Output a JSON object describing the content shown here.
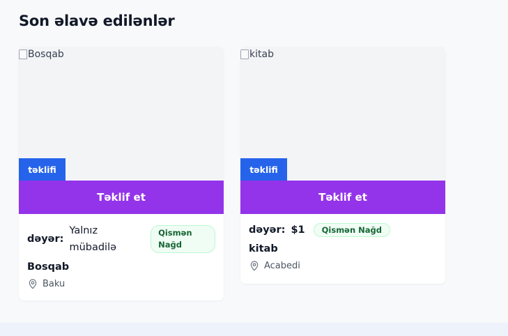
{
  "section": {
    "title": "Son əlavə edilənlər"
  },
  "cards": [
    {
      "image_alt": "Bosqab",
      "badge": "təklifi",
      "offer_button": "Təklif et",
      "value_label": "dəyər:",
      "value": "Yalnız mübadilə",
      "payment_tag": "Qismən Nağd",
      "title": "Bosqab",
      "location": "Baku"
    },
    {
      "image_alt": "kitab",
      "badge": "təklifi",
      "offer_button": "Təklif et",
      "value_label": "dəyər:",
      "value": "$1",
      "payment_tag": "Qismən Nağd",
      "title": "kitab",
      "location": "Acabedi"
    }
  ],
  "colors": {
    "badge_blue": "#2563eb",
    "offer_purple": "#9333ea",
    "tag_green": "#166534"
  }
}
